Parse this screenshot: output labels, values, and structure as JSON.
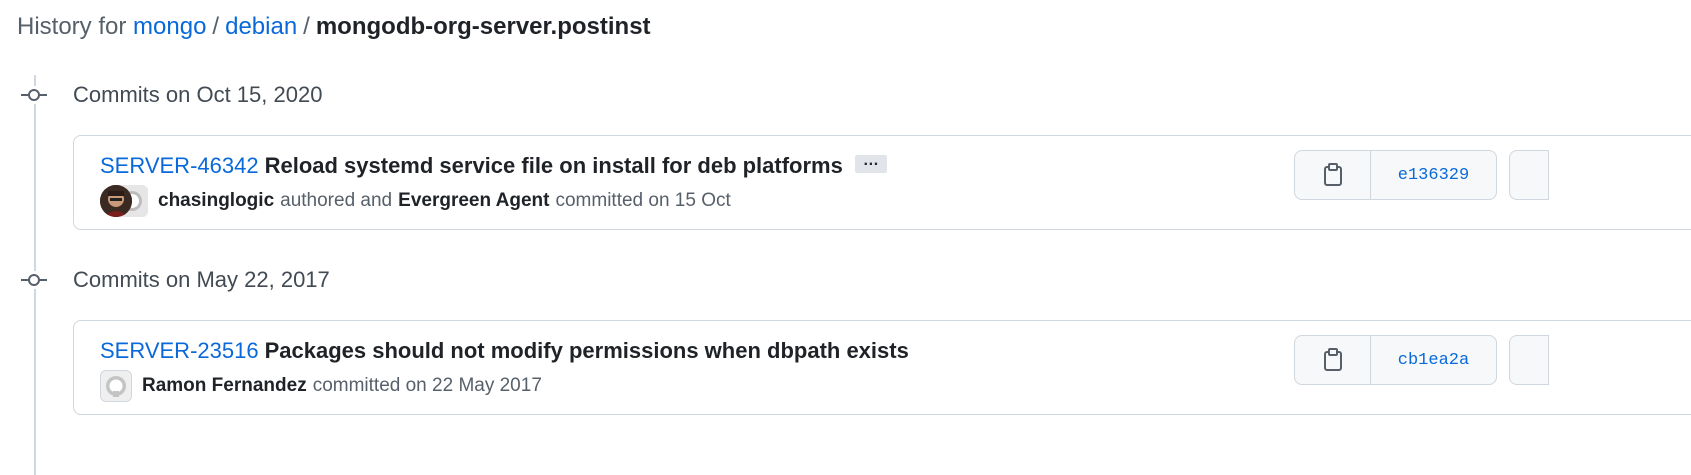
{
  "header": {
    "prefix": "History for",
    "owner": "mongo",
    "separator": "/",
    "folder": "debian",
    "file": "mongodb-org-server.postinst"
  },
  "groups": [
    {
      "date_label": "Commits on Oct 15, 2020",
      "commit": {
        "issue": "SERVER-46342",
        "message": "Reload systemd service file on install for deb platforms",
        "has_more": true,
        "more_label": "…",
        "author": "chasinglogic",
        "authored_text": "authored and",
        "committer": "Evergreen Agent",
        "committed_text": "committed on 15 Oct",
        "sha": "e136329"
      }
    },
    {
      "date_label": "Commits on May 22, 2017",
      "commit": {
        "issue": "SERVER-23516",
        "message": "Packages should not modify permissions when dbpath exists",
        "author": "Ramon Fernandez",
        "committed_text": "committed on 22 May 2017",
        "sha": "cb1ea2a"
      }
    }
  ],
  "colors": {
    "link": "#0969da",
    "text": "#1f2328",
    "muted": "#57606a",
    "border": "#d0d7de"
  }
}
